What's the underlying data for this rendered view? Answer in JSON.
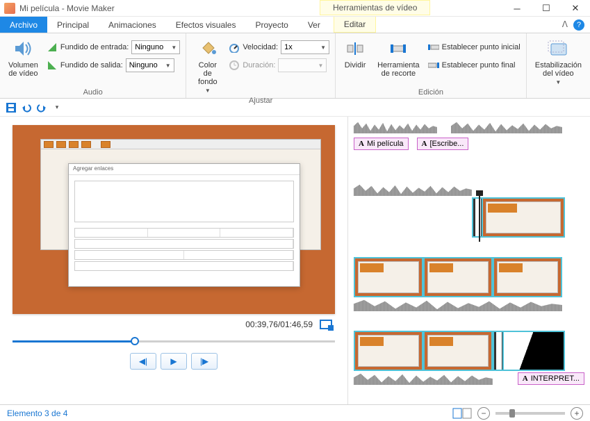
{
  "window": {
    "title": "Mi película - Movie Maker",
    "context_tab": "Herramientas de vídeo"
  },
  "tabs": {
    "file": "Archivo",
    "principal": "Principal",
    "animaciones": "Animaciones",
    "efectos": "Efectos visuales",
    "proyecto": "Proyecto",
    "ver": "Ver",
    "editar": "Editar"
  },
  "ribbon": {
    "volumen": "Volumen\nde vídeo",
    "audio_group": "Audio",
    "fundido_entrada": "Fundido de entrada:",
    "fundido_salida": "Fundido de salida:",
    "ninguno": "Ninguno",
    "color_fondo": "Color de\nfondo",
    "velocidad": "Velocidad:",
    "velocidad_val": "1x",
    "duracion": "Duración:",
    "duracion_val": "",
    "ajustar_group": "Ajustar",
    "dividir": "Dividir",
    "herramienta_recorte": "Herramienta\nde recorte",
    "punto_inicial": "Establecer punto inicial",
    "punto_final": "Establecer punto final",
    "edicion_group": "Edición",
    "estabilizacion": "Estabilización\ndel vídeo",
    "estab_group": ""
  },
  "preview": {
    "time": "00:39,76/01:46,59"
  },
  "timeline": {
    "title1": "Mi película",
    "title2": "[Escribe...",
    "title3": "INTERPRET..."
  },
  "status": {
    "element": "Elemento 3 de 4"
  }
}
